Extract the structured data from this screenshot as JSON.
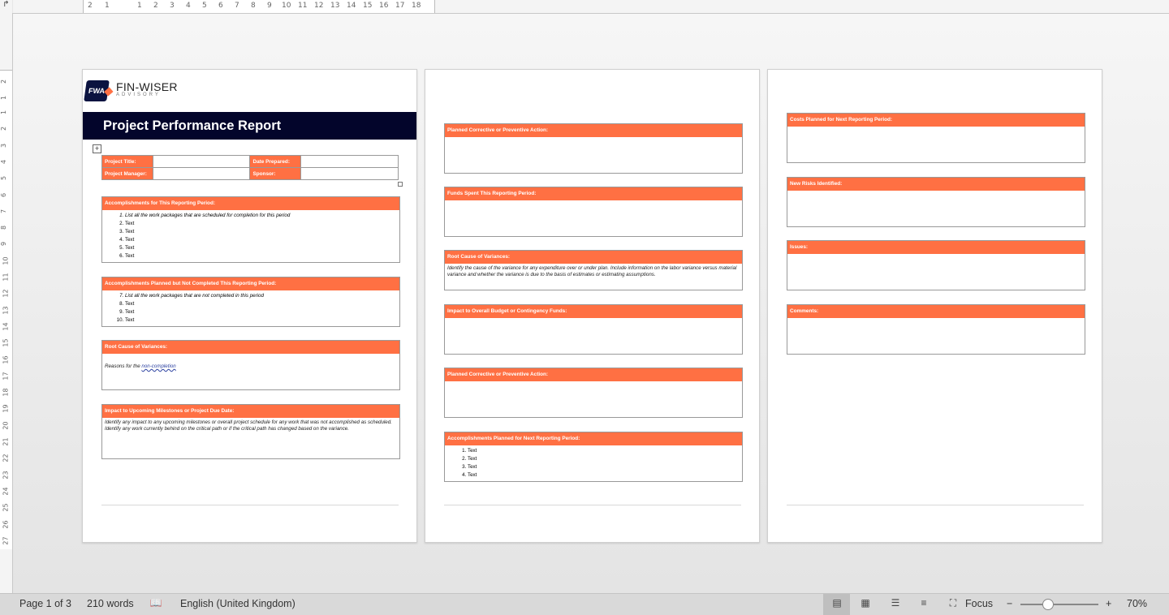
{
  "ruler": {
    "top_ticks": [
      "2",
      "1",
      "1",
      "2",
      "3",
      "4",
      "5",
      "6",
      "7",
      "8",
      "9",
      "10",
      "11",
      "12",
      "13",
      "14",
      "15",
      "16",
      "17",
      "18"
    ],
    "left_ticks": [
      "2",
      "1",
      "1",
      "2",
      "3",
      "4",
      "5",
      "6",
      "7",
      "8",
      "9",
      "10",
      "11",
      "12",
      "13",
      "14",
      "15",
      "16",
      "17",
      "18",
      "19",
      "20",
      "21",
      "22",
      "23",
      "24",
      "25",
      "26",
      "27"
    ]
  },
  "logo": {
    "mark": "FWA",
    "name": "FIN-WISER",
    "sub": "ADVISORY"
  },
  "page1": {
    "title": "Project Performance Report",
    "info": {
      "project_title": "Project Title:",
      "date_prepared": "Date Prepared:",
      "project_manager": "Project Manager:",
      "sponsor": "Sponsor:"
    },
    "acc_this": {
      "header": "Accomplishments for This Reporting Period:",
      "items": [
        "List all the work packages that are scheduled for completion for this period",
        "Text",
        "Text",
        "Text",
        "Text",
        "Text"
      ]
    },
    "acc_not": {
      "header": "Accomplishments Planned but Not Completed This Reporting Period:",
      "items": [
        "List all the work packages that are not completed in this period",
        "Text",
        "Text",
        "Text"
      ]
    },
    "root": {
      "header": "Root Cause of Variances:",
      "text": "Reasons for the ",
      "link": "non-completion"
    },
    "impact": {
      "header": "Impact to Upcoming Milestones or Project Due Date:",
      "text": "Identify any impact to any upcoming milestones or overall project schedule for any work that was not accomplished as scheduled. Identify any work currently behind on the critical path or if the critical path has changed based on the variance."
    }
  },
  "page2": {
    "corrective1": "Planned Corrective or Preventive Action:",
    "funds": "Funds Spent This Reporting Period:",
    "root_header": "Root Cause of Variances:",
    "root_text": "Identify the cause of the variance for any expenditure over or under plan. Include information on the labor variance versus material variance and whether the variance is due to the basis of estimates or estimating assumptions.",
    "impact_budget": "Impact to Overall Budget or Contingency Funds:",
    "corrective2": "Planned Corrective or Preventive Action:",
    "acc_next": {
      "header": "Accomplishments Planned for Next Reporting Period:",
      "items": [
        "Text",
        "Text",
        "Text",
        "Text"
      ]
    }
  },
  "page3": {
    "costs": "Costs Planned for Next Reporting Period:",
    "risks": "New Risks Identified:",
    "issues": "Issues:",
    "comments": "Comments:"
  },
  "status": {
    "page": "Page 1 of 3",
    "words": "210 words",
    "language": "English (United Kingdom)",
    "focus": "Focus",
    "zoom": "70%",
    "zoom_minus": "−",
    "zoom_plus": "+"
  },
  "colors": {
    "accent": "#ff7043",
    "title_bar": "#03052b"
  }
}
